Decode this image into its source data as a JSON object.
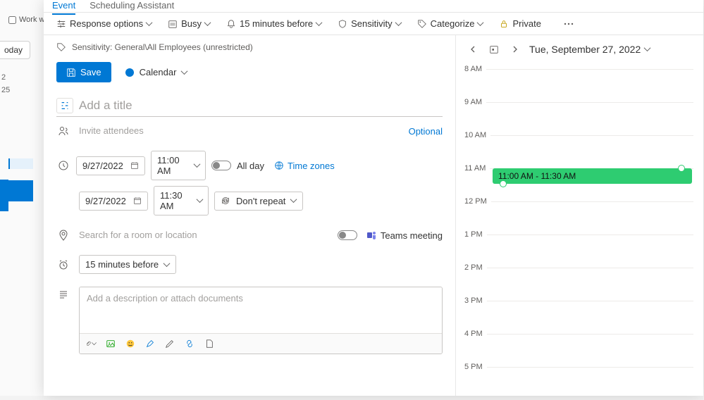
{
  "background": {
    "today_btn": "oday",
    "work_week": "Work we",
    "num1": "2",
    "num2": "25"
  },
  "tabs": {
    "event": "Event",
    "scheduling": "Scheduling Assistant"
  },
  "toolbar": {
    "response_options": "Response options",
    "busy": "Busy",
    "reminder": "15 minutes before",
    "sensitivity": "Sensitivity",
    "categorize": "Categorize",
    "private": "Private"
  },
  "sensitivity_bar": "Sensitivity: General\\All Employees (unrestricted)",
  "save_label": "Save",
  "calendar_select": "Calendar",
  "title_placeholder": "Add a title",
  "attendees_placeholder": "Invite attendees",
  "optional_label": "Optional",
  "datetime": {
    "start_date": "9/27/2022",
    "start_time": "11:00 AM",
    "end_date": "9/27/2022",
    "end_time": "11:30 AM",
    "all_day": "All day",
    "time_zones": "Time zones",
    "repeat": "Don't repeat"
  },
  "location_placeholder": "Search for a room or location",
  "teams_meeting": "Teams meeting",
  "reminder_field": "15 minutes before",
  "description_placeholder": "Add a description or attach documents",
  "mini_cal": {
    "date_label": "Tue, September 27, 2022",
    "hours": [
      "8 AM",
      "9 AM",
      "10 AM",
      "11 AM",
      "12 PM",
      "1 PM",
      "2 PM",
      "3 PM",
      "4 PM",
      "5 PM"
    ],
    "event_text": "11:00 AM - 11:30 AM"
  }
}
